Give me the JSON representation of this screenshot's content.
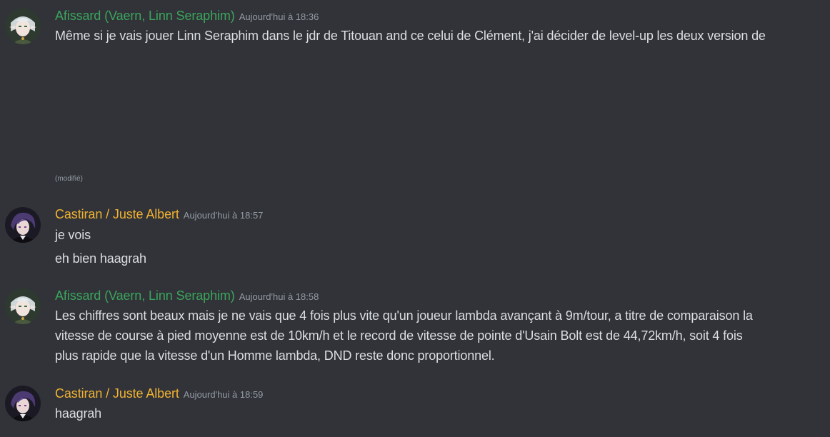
{
  "messages": [
    {
      "author": "Afissard (Vaern, Linn Seraphim)",
      "author_color": "#3ba55d",
      "timestamp": "Aujourd'hui à 18:36",
      "lines": [
        "Même si je vais jouer Linn Seraphim dans le jdr de Titouan and ce celui de Clément, j'ai décider de level-up les deux version de"
      ],
      "edited_label": "(modifié)"
    },
    {
      "author": "Castiran / Juste Albert",
      "author_color": "#f0b232",
      "timestamp": "Aujourd'hui à 18:57",
      "lines": [
        "je vois",
        "eh bien haagrah"
      ]
    },
    {
      "author": "Afissard (Vaern, Linn Seraphim)",
      "author_color": "#3ba55d",
      "timestamp": "Aujourd'hui à 18:58",
      "lines": [
        "Les chiffres sont beaux mais je ne vais que 4 fois plus vite qu'un joueur lambda avançant à 9m/tour, a titre de comparaison la",
        "vitesse de course à pied moyenne est de 10km/h et le record de vitesse de pointe d'Usain Bolt est de 44,72km/h, soit 4 fois",
        "plus rapide que la vitesse d'un Homme lambda, DND reste donc proportionnel."
      ]
    },
    {
      "author": "Castiran / Juste Albert",
      "author_color": "#f0b232",
      "timestamp": "Aujourd'hui à 18:59",
      "lines": [
        "haagrah"
      ]
    }
  ]
}
